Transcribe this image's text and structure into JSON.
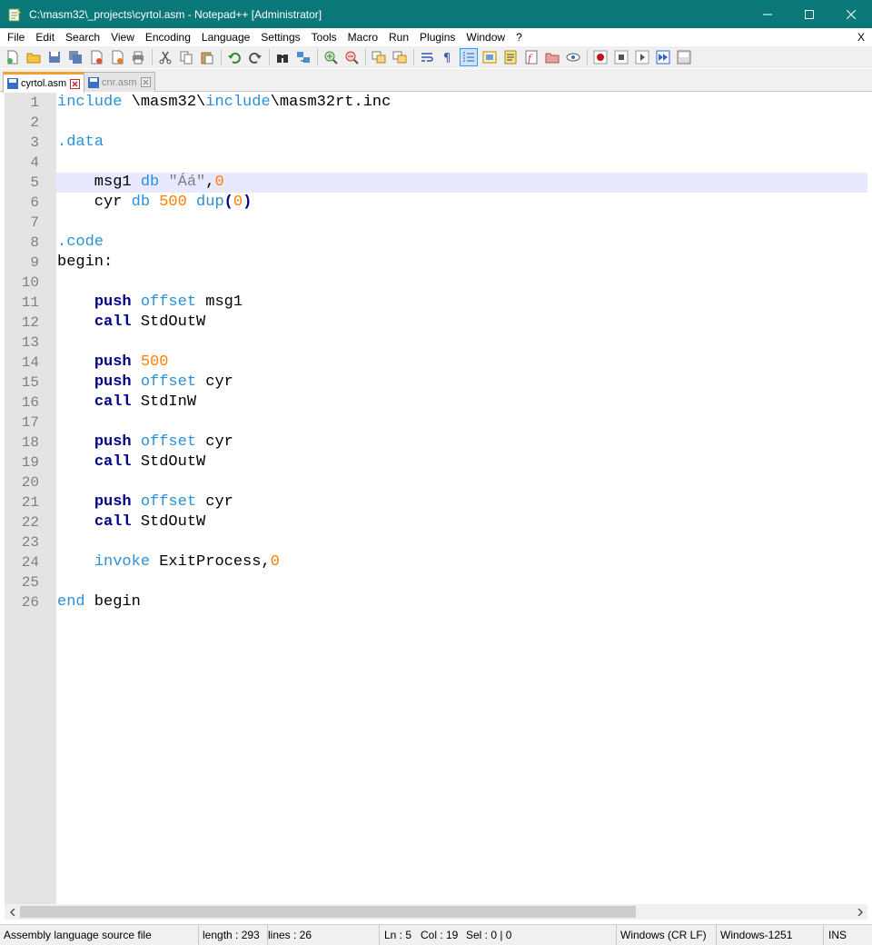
{
  "window": {
    "title": "C:\\masm32\\_projects\\cyrtol.asm - Notepad++ [Administrator]",
    "minimize": "—",
    "maximize": "☐",
    "close": "✕"
  },
  "menu": {
    "items": [
      "File",
      "Edit",
      "Search",
      "View",
      "Encoding",
      "Language",
      "Settings",
      "Tools",
      "Macro",
      "Run",
      "Plugins",
      "Window",
      "?"
    ],
    "close_label": "X"
  },
  "toolbar": {
    "buttons": [
      "new-file",
      "open-file",
      "save",
      "save-all",
      "close",
      "close-all",
      "print",
      "cut",
      "copy",
      "paste",
      "undo",
      "redo",
      "find",
      "replace",
      "zoom-in",
      "zoom-out",
      "sync-vertical",
      "sync-horizontal",
      "word-wrap",
      "show-all-characters",
      "indent-guide",
      "user-defined-language",
      "document-map",
      "function-list",
      "folder-as-workspace",
      "monitoring",
      "record-macro",
      "stop-recording",
      "play-macro",
      "run-macro-multiple",
      "save-macro"
    ],
    "active_button": "indent-guide"
  },
  "tabs": [
    {
      "label": "cyrtol.asm",
      "active": true
    },
    {
      "label": "cnr.asm",
      "active": false
    }
  ],
  "editor": {
    "current_line": 5,
    "lines": [
      {
        "n": "1",
        "tokens": [
          {
            "t": "include",
            "c": "dir"
          },
          {
            "t": " \\masm32\\",
            "c": ""
          },
          {
            "t": "include",
            "c": "dir"
          },
          {
            "t": "\\masm32rt.inc",
            "c": ""
          }
        ]
      },
      {
        "n": "2",
        "tokens": []
      },
      {
        "n": "3",
        "tokens": [
          {
            "t": ".data",
            "c": "dir"
          }
        ]
      },
      {
        "n": "4",
        "tokens": []
      },
      {
        "n": "5",
        "tokens": [
          {
            "t": "    msg1 ",
            "c": ""
          },
          {
            "t": "db",
            "c": "dir"
          },
          {
            "t": " ",
            "c": ""
          },
          {
            "t": "\"Áá\"",
            "c": "str"
          },
          {
            "t": ",",
            "c": ""
          },
          {
            "t": "0",
            "c": "num"
          }
        ]
      },
      {
        "n": "6",
        "tokens": [
          {
            "t": "    cyr ",
            "c": ""
          },
          {
            "t": "db",
            "c": "dir"
          },
          {
            "t": " ",
            "c": ""
          },
          {
            "t": "500",
            "c": "num"
          },
          {
            "t": " ",
            "c": ""
          },
          {
            "t": "dup",
            "c": "dir"
          },
          {
            "t": "(",
            "c": "op"
          },
          {
            "t": "0",
            "c": "num"
          },
          {
            "t": ")",
            "c": "op"
          }
        ]
      },
      {
        "n": "7",
        "tokens": []
      },
      {
        "n": "8",
        "tokens": [
          {
            "t": ".code",
            "c": "dir"
          }
        ]
      },
      {
        "n": "9",
        "tokens": [
          {
            "t": "begin:",
            "c": ""
          }
        ]
      },
      {
        "n": "10",
        "tokens": []
      },
      {
        "n": "11",
        "tokens": [
          {
            "t": "    ",
            "c": ""
          },
          {
            "t": "push",
            "c": "ins"
          },
          {
            "t": " ",
            "c": ""
          },
          {
            "t": "offset",
            "c": "dir"
          },
          {
            "t": " msg1",
            "c": ""
          }
        ]
      },
      {
        "n": "12",
        "tokens": [
          {
            "t": "    ",
            "c": ""
          },
          {
            "t": "call",
            "c": "ins"
          },
          {
            "t": " StdOutW",
            "c": ""
          }
        ]
      },
      {
        "n": "13",
        "tokens": []
      },
      {
        "n": "14",
        "tokens": [
          {
            "t": "    ",
            "c": ""
          },
          {
            "t": "push",
            "c": "ins"
          },
          {
            "t": " ",
            "c": ""
          },
          {
            "t": "500",
            "c": "num"
          }
        ]
      },
      {
        "n": "15",
        "tokens": [
          {
            "t": "    ",
            "c": ""
          },
          {
            "t": "push",
            "c": "ins"
          },
          {
            "t": " ",
            "c": ""
          },
          {
            "t": "offset",
            "c": "dir"
          },
          {
            "t": " cyr",
            "c": ""
          }
        ]
      },
      {
        "n": "16",
        "tokens": [
          {
            "t": "    ",
            "c": ""
          },
          {
            "t": "call",
            "c": "ins"
          },
          {
            "t": " StdInW",
            "c": ""
          }
        ]
      },
      {
        "n": "17",
        "tokens": []
      },
      {
        "n": "18",
        "tokens": [
          {
            "t": "    ",
            "c": ""
          },
          {
            "t": "push",
            "c": "ins"
          },
          {
            "t": " ",
            "c": ""
          },
          {
            "t": "offset",
            "c": "dir"
          },
          {
            "t": " cyr",
            "c": ""
          }
        ]
      },
      {
        "n": "19",
        "tokens": [
          {
            "t": "    ",
            "c": ""
          },
          {
            "t": "call",
            "c": "ins"
          },
          {
            "t": " StdOutW",
            "c": ""
          }
        ]
      },
      {
        "n": "20",
        "tokens": []
      },
      {
        "n": "21",
        "tokens": [
          {
            "t": "    ",
            "c": ""
          },
          {
            "t": "push",
            "c": "ins"
          },
          {
            "t": " ",
            "c": ""
          },
          {
            "t": "offset",
            "c": "dir"
          },
          {
            "t": " cyr",
            "c": ""
          }
        ]
      },
      {
        "n": "22",
        "tokens": [
          {
            "t": "    ",
            "c": ""
          },
          {
            "t": "call",
            "c": "ins"
          },
          {
            "t": " StdOutW",
            "c": ""
          }
        ]
      },
      {
        "n": "23",
        "tokens": []
      },
      {
        "n": "24",
        "tokens": [
          {
            "t": "    ",
            "c": ""
          },
          {
            "t": "invoke",
            "c": "dir"
          },
          {
            "t": " ExitProcess",
            "c": ""
          },
          {
            "t": ",",
            "c": ""
          },
          {
            "t": "0",
            "c": "num"
          }
        ]
      },
      {
        "n": "25",
        "tokens": []
      },
      {
        "n": "26",
        "tokens": [
          {
            "t": "end",
            "c": "dir"
          },
          {
            "t": " begin",
            "c": ""
          }
        ]
      }
    ]
  },
  "scrollbar": {
    "thumb_fraction": 0.74
  },
  "status": {
    "file_type": "Assembly language source file",
    "length": "length : 293",
    "lines": "lines : 26",
    "ln": "Ln : 5",
    "col": "Col : 19",
    "sel": "Sel : 0 | 0",
    "eol": "Windows (CR LF)",
    "encoding": "Windows-1251",
    "mode": "INS"
  },
  "colors": {
    "titlebar": "#0a7878",
    "directive": "#2a90d8",
    "instruction": "#00008b",
    "number": "#ff8000",
    "string": "#808080",
    "current_line": "#e8e8ff",
    "active_tab_accent": "#f4a030"
  }
}
